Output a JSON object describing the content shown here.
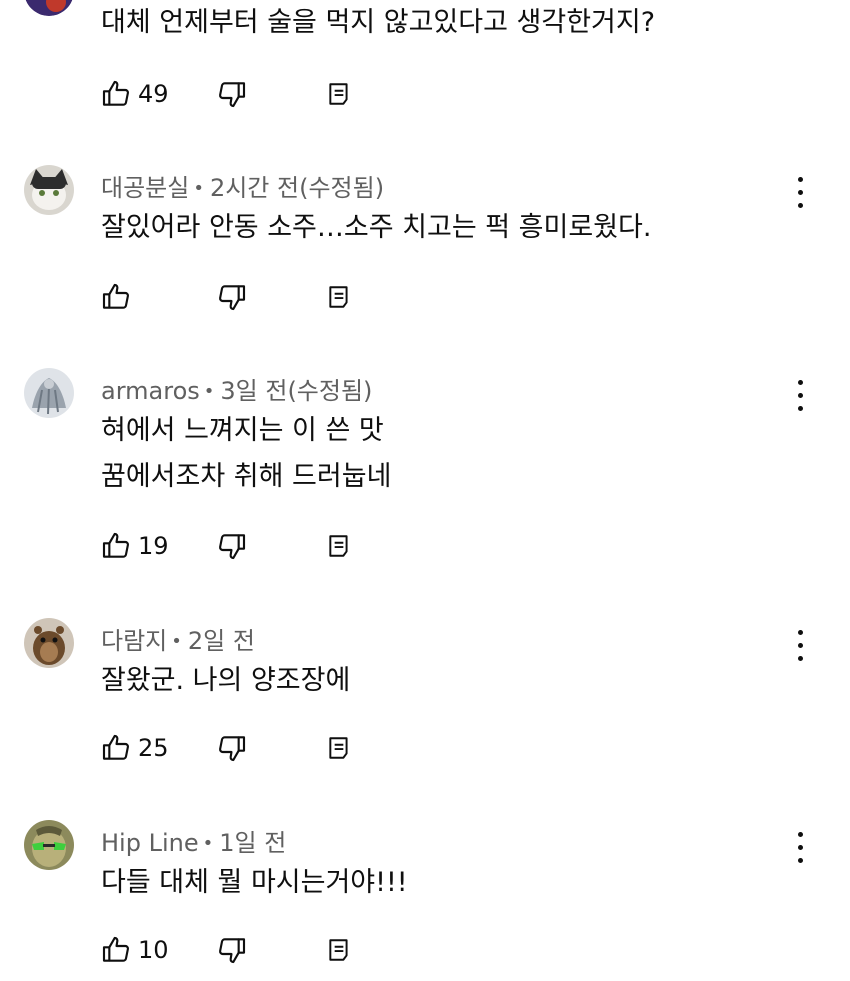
{
  "comments": [
    {
      "id": "c0",
      "author": "",
      "time": "",
      "lines": [
        "대체 언제부터 술을 먹지 않고있다고 생각한거지?"
      ],
      "likes": "49",
      "avatar_colors": [
        "#3b2a6e",
        "#c0392b"
      ],
      "partial": true
    },
    {
      "id": "c1",
      "author": "대공분실",
      "time": "2시간 전(수정됨)",
      "lines": [
        "잘있어라 안동 소주…소주 치고는 퍽 흥미로웠다."
      ],
      "likes": "",
      "avatar_colors": [
        "#2d2d2d",
        "#e8e6e1"
      ]
    },
    {
      "id": "c2",
      "author": "armaros",
      "time": "3일 전(수정됨)",
      "lines": [
        "혀에서 느껴지는 이 쓴 맛",
        "꿈에서조차 취해 드러눕네"
      ],
      "likes": "19",
      "avatar_colors": [
        "#9aa3ad",
        "#dfe3e8"
      ]
    },
    {
      "id": "c3",
      "author": "다람지",
      "time": "2일 전",
      "lines": [
        "잘왔군. 나의 양조장에"
      ],
      "likes": "25",
      "avatar_colors": [
        "#6b4a2b",
        "#a67c52"
      ]
    },
    {
      "id": "c4",
      "author": "Hip Line",
      "time": "1일 전",
      "lines": [
        "다들 대체 뭘 마시는거야!!!"
      ],
      "likes": "10",
      "avatar_colors": [
        "#6b6b3a",
        "#3ecf3e"
      ]
    }
  ],
  "separator": "•",
  "icons": {
    "like": "thumbs-up-icon",
    "dislike": "thumbs-down-icon",
    "reply": "reply-icon",
    "more": "more-vert-icon"
  }
}
